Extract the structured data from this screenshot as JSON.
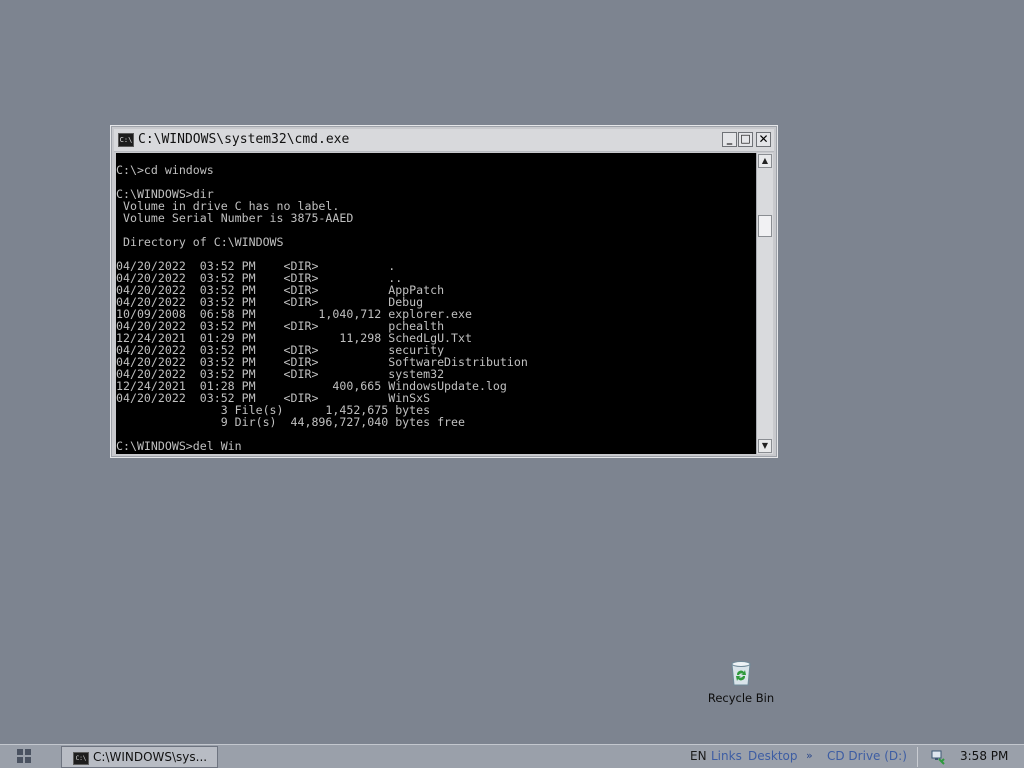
{
  "window": {
    "title": "C:\\WINDOWS\\system32\\cmd.exe",
    "icon_text": "C:\\",
    "buttons": {
      "minimize": "_",
      "maximize": "□",
      "close": "✕"
    }
  },
  "console": {
    "lines": [
      "C:\\>cd windows",
      "",
      "C:\\WINDOWS>dir",
      " Volume in drive C has no label.",
      " Volume Serial Number is 3875-AAED",
      "",
      " Directory of C:\\WINDOWS",
      "",
      "04/20/2022  03:52 PM    <DIR>          .",
      "04/20/2022  03:52 PM    <DIR>          ..",
      "04/20/2022  03:52 PM    <DIR>          AppPatch",
      "04/20/2022  03:52 PM    <DIR>          Debug",
      "10/09/2008  06:58 PM         1,040,712 explorer.exe",
      "04/20/2022  03:52 PM    <DIR>          pchealth",
      "12/24/2021  01:29 PM            11,298 SchedLgU.Txt",
      "04/20/2022  03:52 PM    <DIR>          security",
      "04/20/2022  03:52 PM    <DIR>          SoftwareDistribution",
      "04/20/2022  03:52 PM    <DIR>          system32",
      "12/24/2021  01:28 PM           400,665 WindowsUpdate.log",
      "04/20/2022  03:52 PM    <DIR>          WinSxS",
      "               3 File(s)      1,452,675 bytes",
      "               9 Dir(s)  44,896,727,040 bytes free",
      "",
      "C:\\WINDOWS>del Win"
    ]
  },
  "desktop": {
    "recycle_bin_label": "Recycle Bin"
  },
  "taskbar": {
    "task_label": "C:\\WINDOWS\\sys...",
    "task_icon_text": "C:\\",
    "language": "EN",
    "links": "Links",
    "desktop": "Desktop",
    "chevron": "»",
    "cd_drive": "CD Drive (D:)",
    "clock": "3:58 PM"
  },
  "icons": [
    "cmd-icon",
    "recycle-bin-icon",
    "start-icon",
    "network-icon",
    "scroll-up-icon",
    "scroll-down-icon"
  ]
}
